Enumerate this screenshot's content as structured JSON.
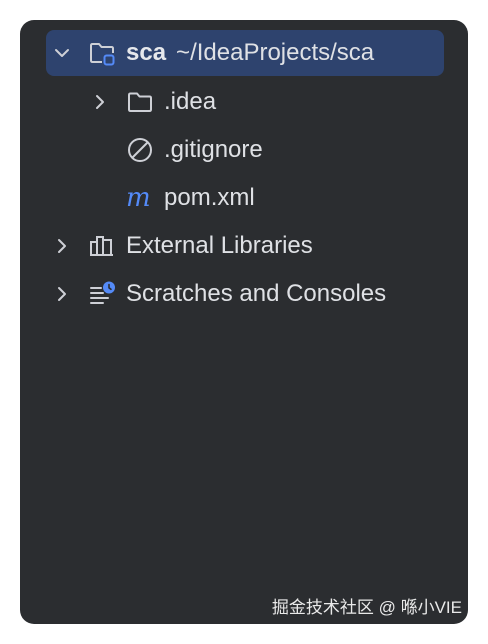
{
  "tree": {
    "root": {
      "name": "sca",
      "path": "~/IdeaProjects/sca",
      "expanded": true,
      "selected": true
    },
    "children": [
      {
        "label": ".idea",
        "icon": "folder-icon",
        "expandable": true
      },
      {
        "label": ".gitignore",
        "icon": "ignored-file-icon",
        "expandable": false
      },
      {
        "label": "pom.xml",
        "icon": "maven-icon",
        "expandable": false
      }
    ],
    "external_libraries": {
      "label": "External Libraries",
      "icon": "libraries-icon"
    },
    "scratches": {
      "label": "Scratches and Consoles",
      "icon": "scratches-icon"
    }
  },
  "watermark": "掘金技术社区 @ 喺小VIE",
  "colors": {
    "panel_bg": "#2b2d30",
    "selection_bg": "#2e436e",
    "text": "#dfe1e5",
    "icon": "#ced0d6",
    "accent": "#548af7"
  }
}
